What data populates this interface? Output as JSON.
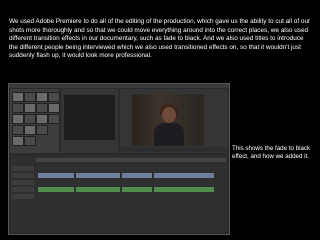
{
  "intro_text": "We used Adobe Premiere to do all of the editing of the production, which gave us the ability to cut all of our shots more thoroughly and so that we could move everything around into the correct places, we also used different transition effects in our documentary, such as fade to black. And we also used titles to introduce the different people being interviewed which we also used transitioned effects on, so that it wouldn't just suddenly flash up, it would look more professional.",
  "caption_text": "This shows the fade to black effect, and how we added it."
}
